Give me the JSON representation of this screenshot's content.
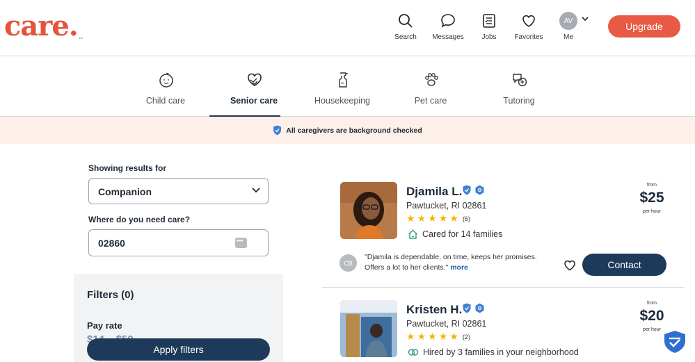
{
  "header": {
    "logo": "care.",
    "logo_tm": "™",
    "nav": [
      {
        "label": "Search",
        "icon": "search-icon"
      },
      {
        "label": "Messages",
        "icon": "messages-icon"
      },
      {
        "label": "Jobs",
        "icon": "jobs-icon"
      },
      {
        "label": "Favorites",
        "icon": "heart-icon"
      }
    ],
    "avatar_initials": "AV",
    "me_label": "Me",
    "upgrade_label": "Upgrade"
  },
  "categories": [
    {
      "label": "Child care",
      "icon": "child-face-icon",
      "active": false
    },
    {
      "label": "Senior care",
      "icon": "heart-hands-icon",
      "active": true
    },
    {
      "label": "Housekeeping",
      "icon": "spray-bottle-icon",
      "active": false
    },
    {
      "label": "Pet care",
      "icon": "paw-icon",
      "active": false
    },
    {
      "label": "Tutoring",
      "icon": "chat-plus-icon",
      "active": false
    }
  ],
  "banner": {
    "text": "All caregivers are background checked",
    "icon": "shield-check-icon"
  },
  "search": {
    "showing_label": "Showing results for",
    "service_value": "Companion",
    "where_label": "Where do you need care?",
    "zip_value": "02860"
  },
  "filters": {
    "title": "Filters (0)",
    "pay_rate_label": "Pay rate",
    "pay_range": "$14 – $50",
    "apply_label": "Apply filters"
  },
  "caregivers": [
    {
      "name": "Djamila L.",
      "location": "Pawtucket, RI 02861",
      "rating": 5,
      "review_count": "(6)",
      "highlight": "Cared for 14 families",
      "highlight_icon": "house-icon",
      "from_label": "from",
      "price": "$25",
      "per_label": "per hour",
      "review_initials": "CB",
      "review_text": "\"Djamila is dependable, on time, keeps her promises. Offers a lot to her clients.\"",
      "review_more": "more",
      "contact_label": "Contact"
    },
    {
      "name": "Kristen H.",
      "location": "Pawtucket, RI 02861",
      "rating": 5,
      "review_count": "(2)",
      "highlight": "Hired by 3 families in your neighborhood",
      "highlight_icon": "linked-rings-icon",
      "from_label": "from",
      "price": "$20",
      "per_label": "per hour"
    }
  ],
  "colors": {
    "brand": "#e5533d",
    "navy": "#1e3a5a",
    "star": "#f5b400",
    "banner_bg": "#fcf0e8"
  }
}
